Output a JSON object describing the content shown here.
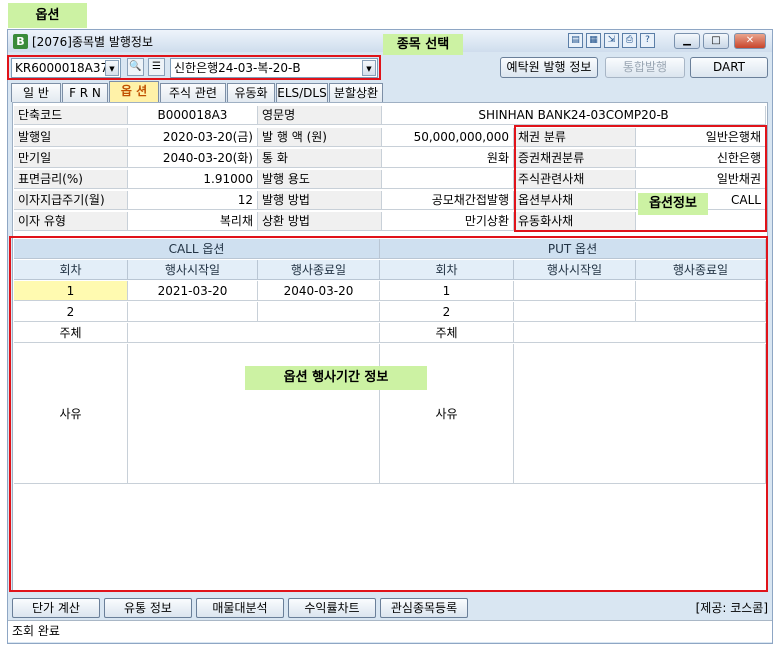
{
  "annotations": {
    "top_caption": "옵션",
    "security_select": "종목 선택",
    "option_info": "옵션정보",
    "exercise_period": "옵션 행사기간 정보"
  },
  "window": {
    "icon_letter": "B",
    "title": "[2076]종목별 발행정보"
  },
  "selector": {
    "code": "KR6000018A37",
    "name": "신한은행24-03-복-20-B"
  },
  "buttons": {
    "depository": "예탁원 발행 정보",
    "integrated": "통합발행",
    "dart": "DART"
  },
  "tabs": [
    "일 반",
    "F R N",
    "옵 션",
    "주식 관련",
    "유동화",
    "ELS/DLS",
    "분할상환"
  ],
  "info": {
    "short_code_label": "단축코드",
    "short_code": "B000018A3",
    "eng_name_label": "영문명",
    "eng_name": "SHINHAN BANK24-03COMP20-B",
    "issue_date_label": "발행일",
    "issue_date": "2020-03-20(금)",
    "amount_label": "발 행 액 (원)",
    "amount": "50,000,000,000",
    "maturity_label": "만기일",
    "maturity": "2040-03-20(화)",
    "currency_label": "통    화",
    "currency": "원화",
    "coupon_label": "표면금리(%)",
    "coupon": "1.91000",
    "purpose_label": "발행 용도",
    "purpose": "",
    "interest_period_label": "이자지급주기(월)",
    "interest_period": "12",
    "method_label": "발행 방법",
    "method": "공모채간접발행",
    "interest_type_label": "이자 유형",
    "interest_type": "복리채",
    "redemption_label": "상환 방법",
    "redemption": "만기상환",
    "bond_class_label": "채권 분류",
    "bond_class": "일반은행채",
    "ksd_class_label": "증권채권분류",
    "ksd_class": "신한은행",
    "equity_label": "주식관련사채",
    "equity": "일반채권",
    "option_bond_label": "옵션부사채",
    "option_bond": "CALL",
    "abs_label": "유동화사채",
    "abs": ""
  },
  "options": {
    "call_header": "CALL 옵션",
    "put_header": "PUT 옵션",
    "round_label": "회차",
    "start_label": "행사시작일",
    "end_label": "행사종료일",
    "call_rows": [
      {
        "round": "1",
        "start": "2021-03-20",
        "end": "2040-03-20"
      },
      {
        "round": "2",
        "start": "",
        "end": ""
      }
    ],
    "put_rows": [
      {
        "round": "1",
        "start": "",
        "end": ""
      },
      {
        "round": "2",
        "start": "",
        "end": ""
      }
    ],
    "subject_label": "주체",
    "reason_label": "사유"
  },
  "bottom_buttons": [
    "단가 계산",
    "유통 정보",
    "매물대분석",
    "수익률차트",
    "관심종목등록"
  ],
  "provider": "[제공: 코스콤]",
  "status": "조회 완료"
}
